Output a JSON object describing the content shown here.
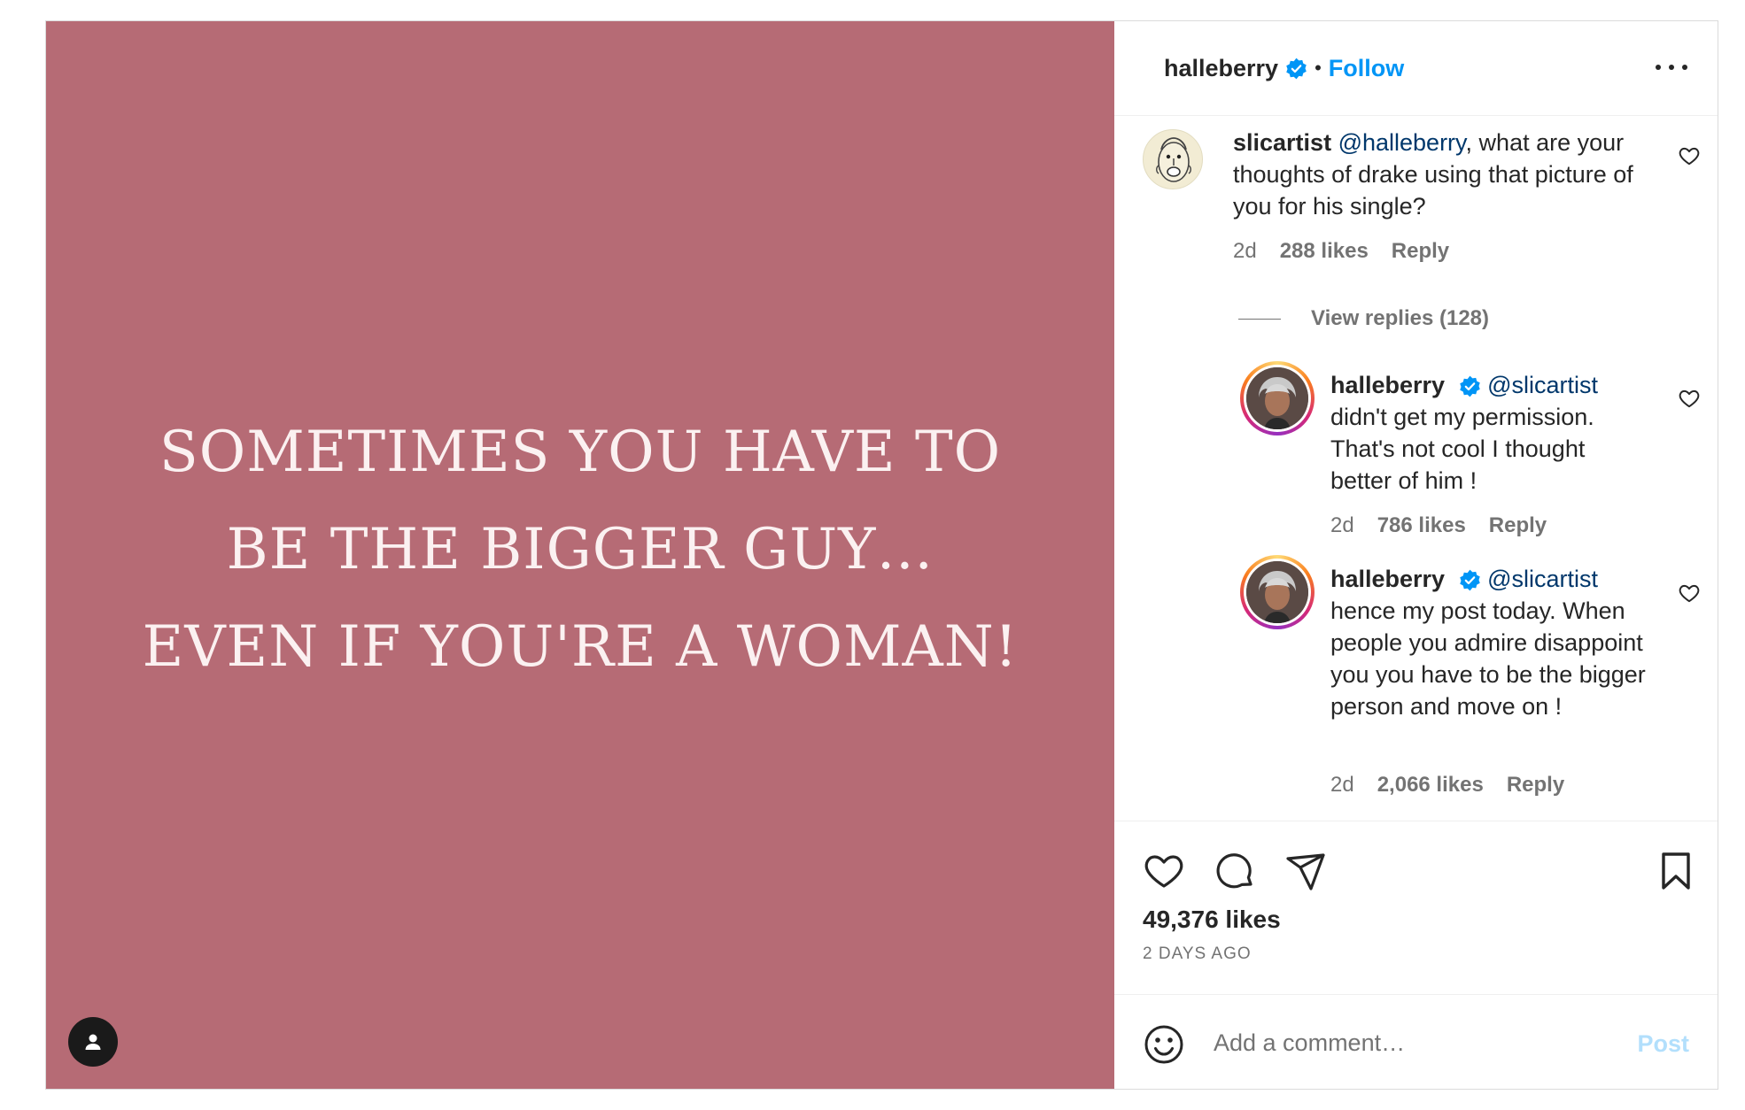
{
  "media": {
    "background_color": "#b66b75",
    "quote": "SOMETIMES YOU HAVE TO BE THE BIGGER GUY… EVEN IF YOU'RE A WOMAN!",
    "tag_icon": "user-icon"
  },
  "header": {
    "username": "halleberry",
    "verified_icon": "verified-badge-icon",
    "separator": "•",
    "follow_label": "Follow",
    "more_icon": "more-options-icon"
  },
  "comments": [
    {
      "username": "slicartist",
      "mention": "@halleberry",
      "text": ", what are your thoughts of drake using that picture of you for his single?",
      "time": "2d",
      "likes": "288 likes",
      "reply_label": "Reply"
    }
  ],
  "view_replies_label": "View replies (128)",
  "replies": [
    {
      "username": "halleberry",
      "mention": "@slicartist",
      "text": "didn't get my permission. That's not cool I thought better of him !",
      "time": "2d",
      "likes": "786 likes",
      "reply_label": "Reply"
    },
    {
      "username": "halleberry",
      "mention": "@slicartist",
      "text": "hence my post today. When people you admire disappoint you you have to be the bigger person and move on !",
      "time": "2d",
      "likes": "2,066 likes",
      "reply_label": "Reply"
    }
  ],
  "actions": {
    "like_icon": "heart-icon",
    "comment_icon": "comment-icon",
    "share_icon": "send-icon",
    "save_icon": "bookmark-icon",
    "likes": "49,376 likes",
    "posted_ago": "2 DAYS AGO"
  },
  "add_comment": {
    "emoji_icon": "emoji-icon",
    "placeholder": "Add a comment…",
    "post_label": "Post"
  },
  "colors": {
    "accent": "#0095f6",
    "mention": "#00376b",
    "muted": "#737373"
  }
}
